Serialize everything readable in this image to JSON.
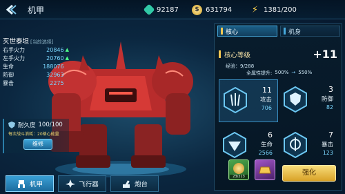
{
  "header": {
    "title": "机甲",
    "resources": {
      "crystal": "92187",
      "coin": "631794",
      "energy": "1381/200"
    }
  },
  "mech": {
    "name": "灭世泰坦",
    "name_tag": "[当前选择]",
    "stats": [
      {
        "label": "右手火力",
        "value": "20846",
        "up": true
      },
      {
        "label": "左手火力",
        "value": "20760",
        "up": true
      },
      {
        "label": "生命",
        "value": "188076",
        "up": false
      },
      {
        "label": "防御",
        "value": "32963",
        "up": false
      },
      {
        "label": "暴击",
        "value": "2275",
        "up": false
      }
    ],
    "durability_label": "耐久度",
    "durability_value": "100/100",
    "durability_note": "每次战斗消耗：20格心能量",
    "repair_label": "维修"
  },
  "panel": {
    "tabs": [
      {
        "label": "核心",
        "active": true
      },
      {
        "label": "机身",
        "active": false
      }
    ],
    "core_title": "核心等级",
    "core_level": "+11",
    "exp": "经验：9/288",
    "boost_label": "全属性提升:",
    "boost_from": "500%",
    "boost_arrow": "→",
    "boost_to": "550%",
    "attributes": [
      {
        "level": "11",
        "name": "攻击",
        "value": "706"
      },
      {
        "level": "3",
        "name": "防御",
        "value": "82"
      },
      {
        "level": "6",
        "name": "生命",
        "value": "2566"
      },
      {
        "level": "7",
        "name": "暴击",
        "value": "123"
      }
    ],
    "item_tag": "23/213",
    "upgrade_label": "强化"
  },
  "nav": [
    {
      "label": "机甲",
      "active": true
    },
    {
      "label": "飞行器",
      "active": false
    },
    {
      "label": "炮台",
      "active": false
    }
  ],
  "colors": {
    "accent_gold": "#f4c852",
    "accent_blue": "#46a9dc",
    "stat_value": "#7ad7ff",
    "stat_up": "#4dff8a"
  }
}
